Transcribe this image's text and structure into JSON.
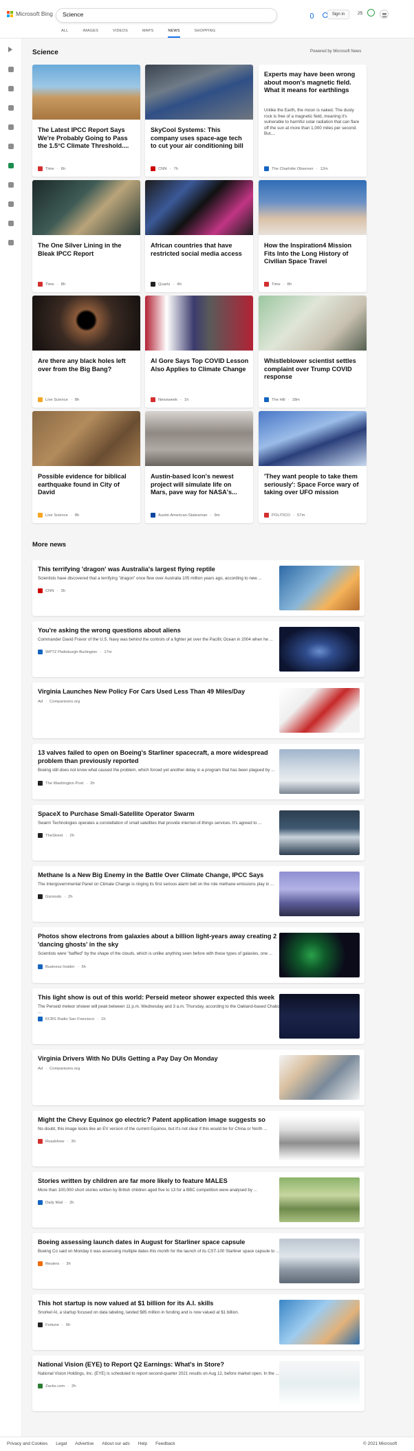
{
  "brand": {
    "name": "Microsoft Bing"
  },
  "search": {
    "query": "Science"
  },
  "header": {
    "signin": "Sign in",
    "points": "25"
  },
  "tabs": [
    {
      "label": "ALL"
    },
    {
      "label": "IMAGES"
    },
    {
      "label": "VIDEOS"
    },
    {
      "label": "MAPS"
    },
    {
      "label": "NEWS",
      "active": true
    },
    {
      "label": "SHOPPING"
    }
  ],
  "section": {
    "title": "Science",
    "powered": "Powered by Microsoft News"
  },
  "cards": [
    {
      "title": "The Latest IPCC Report Says We're Probably Going to Pass the 1.5°C Climate Threshold....",
      "source": "Time",
      "time": "6h",
      "accent": "#d32f2f",
      "img": "linear-gradient(180deg,#6aa9d8 0%,#9cc7e6 40%,#c89a62 60%,#a8763f 100%)"
    },
    {
      "title": "SkyCool Systems: This company uses space-age tech to cut your air conditioning bill",
      "source": "CNN",
      "time": "7h",
      "accent": "#cc0000",
      "img": "linear-gradient(160deg,#3b4450 0%,#6f7b88 35%,#2f4f86 55%,#6e7680 100%)"
    },
    {
      "title": "Experts may have been wrong about moon's magnetic field. What it means for earthlings",
      "summary": "Unlike the Earth, the moon is naked. The dusty rock is free of a magnetic field, meaning it's vulnerable to harmful solar radiation that can flare off the sun at more than 1,000 miles per second. But....",
      "source": "The Charlotte Observer",
      "time": "12m",
      "accent": "#1565c0",
      "textonly": true
    },
    {
      "title": "The One Silver Lining in the Bleak IPCC Report",
      "source": "Time",
      "time": "8h",
      "accent": "#d32f2f",
      "img": "linear-gradient(135deg,#1c2a2a 0%,#3e5b55 40%,#b9a47a 60%,#2a3a35 100%)"
    },
    {
      "title": "African countries that have restricted social media access",
      "source": "Quartz",
      "time": "4h",
      "accent": "#222222",
      "img": "linear-gradient(135deg,#1d1d1d 0%,#3b5998 30%,#111 50%,#c13584 75%,#1d1d1d 100%)"
    },
    {
      "title": "How the Inspiration4 Mission Fits Into the Long History of Civilian Space Travel",
      "source": "Time",
      "time": "8h",
      "accent": "#d32f2f",
      "img": "linear-gradient(180deg,#2f6db6 0%,#6a91c6 40%,#d9c1a8 70%,#e8e2da 100%)"
    },
    {
      "title": "Are there any black holes left over from the Big Bang?",
      "source": "Live Science",
      "time": "8h",
      "accent": "#f5a623",
      "img": "radial-gradient(circle at 50% 45%,#000 0,#000 12px,#8a5a3a 16px,#3a2a22 40px,#1a1412 80px)"
    },
    {
      "title": "Al Gore Says Top COVID Lesson Also Applies to Climate Change",
      "source": "Newsweek",
      "time": "1h",
      "accent": "#d32f2f",
      "img": "linear-gradient(90deg,#b22234 0%,#ffffff 20%,#3c3b6e 45%,#5a5a5a 60%,#b22234 100%)"
    },
    {
      "title": "Whistleblower scientist settles complaint over Trump COVID response",
      "source": "The Hill",
      "time": "18m",
      "accent": "#1565c0",
      "img": "linear-gradient(135deg,#9cc7a0 0%,#dfe6d8 40%,#c8c0b0 70%,#556050 100%)"
    },
    {
      "title": "Possible evidence for biblical earthquake found in City of David",
      "source": "Live Science",
      "time": "8h",
      "accent": "#f5a623",
      "img": "linear-gradient(135deg,#8a6a45 0%,#b38b5c 40%,#6a4e32 70%,#a27d51 100%)"
    },
    {
      "title": "Austin-based Icon's newest project will simulate life on Mars, pave way for NASA's...",
      "source": "Austin American-Statesman",
      "time": "9m",
      "accent": "#0d47a1",
      "img": "linear-gradient(180deg,#d8d4d0 0%,#8f8883 40%,#b0aaa5 70%,#6b6560 100%)"
    },
    {
      "title": "'They want people to take them seriously': Space Force wary of taking over UFO mission",
      "source": "POLITICO",
      "time": "57m",
      "accent": "#d32f2f",
      "img": "linear-gradient(160deg,#4a78c8 0%,#9bbce8 40%,#2a3f7a 60%,#c8d8ee 100%)"
    }
  ],
  "more_news": {
    "title": "More news",
    "items": [
      {
        "title": "This terrifying 'dragon' was Australia's largest flying reptile",
        "summary": "Scientists have discovered that a terrifying \"dragon\" once flew over Australia 105 million years ago, according to new ...",
        "source": "CNN",
        "time": "3h",
        "accent": "#cc0000",
        "img": "linear-gradient(135deg,#2e6aa7 0%,#88b6d9 45%,#f4b35a 70%,#b56a2a 100%)"
      },
      {
        "title": "You're asking the wrong questions about aliens",
        "summary": "Commander David Fravor of the U.S. Navy was behind the controls of a fighter jet over the Pacific Ocean in 2004 when he ...",
        "source": "WPTZ Plattsburgh-Burlington",
        "time": "17m",
        "accent": "#1565c0",
        "img": "radial-gradient(ellipse at 50% 55%,#6a8ed0 0,#2f4c8c 20px,#0d1430 60px)"
      },
      {
        "title": "Virginia Launches New Policy For Cars Used Less Than 49 Miles/Day",
        "summary": "",
        "source": "Comparisons.org",
        "ad": "Ad",
        "time": "",
        "accent": "#999999",
        "img": "linear-gradient(135deg,#ffffff 0%,#efefef 30%,#c62828 55%,#f2f2f2 80%)"
      },
      {
        "title": "13 valves failed to open on Boeing's Starliner spacecraft, a more widespread problem than previously reported",
        "summary": "Boeing still does not know what caused the problem, which forced yet another delay in a program that has been plagued by ...",
        "source": "The Washington Post",
        "time": "2h",
        "accent": "#222222",
        "img": "linear-gradient(180deg,#9fb4cc 0%,#cfd8e2 40%,#e8ecf0 70%,#7c8794 100%)"
      },
      {
        "title": "SpaceX to Purchase Small-Satellite Operator Swarm",
        "summary": "Swarm Technologies operates a constellation of small satellites that provide internet-of-things services. It's agreed to ...",
        "source": "TheStreet",
        "time": "2h",
        "accent": "#222222",
        "img": "linear-gradient(180deg,#2d3e50 0%,#3f5870 40%,#c9d3dc 60%,#2d3e50 100%)"
      },
      {
        "title": "Methane Is a New Big Enemy in the Battle Over Climate Change, IPCC Says",
        "summary": "The Intergovernmental Panel on Climate Change is ringing its first serious alarm bell on the role methane emissions play in ...",
        "source": "Gizmodo",
        "time": "2h",
        "accent": "#222222",
        "img": "linear-gradient(180deg,#8f8fd2 0%,#b3b3e6 40%,#5d5d9a 70%,#2e2e4a 100%)"
      },
      {
        "title": "Photos show electrons from galaxies about a billion light-years away creating 2 'dancing ghosts' in the sky",
        "summary": "Scientists were \"baffled\" by the shape of the clouds, which is unlike anything seen before with these types of galaxies, one ...",
        "source": "Business Insider",
        "time": "5h",
        "accent": "#1565c0",
        "img": "radial-gradient(circle at 40% 50%,#2aa04a 0,#0f5a2a 20px,#0b0b1a 50px)"
      },
      {
        "title": "This light show is out of this world: Perseid meteor shower expected this week",
        "summary": "The Perseid meteor shower will peak between 11 p.m. Wednesday and 3 a.m. Thursday, according to the Oakland-based Chabot ...",
        "source": "KCBS Radio San Francisco",
        "time": "1h",
        "accent": "#1565c0",
        "img": "linear-gradient(180deg,#0c1024 0%,#1b2448 50%,#10183a 100%)"
      },
      {
        "title": "Virginia Drivers With No DUIs Getting a Pay Day On Monday",
        "summary": "",
        "source": "Comparisons.org",
        "ad": "Ad",
        "time": "",
        "accent": "#999999",
        "img": "linear-gradient(135deg,#f2f2f2 0%,#d9c0a0 30%,#7a8a9a 60%,#f2f2f2 100%)"
      },
      {
        "title": "Might the Chevy Equinox go electric? Patent application image suggests so",
        "summary": "No doubt, this image looks like an EV version of the current Equinox, but it's not clear if this would be for China or North ...",
        "source": "Roadshow",
        "time": "3h",
        "accent": "#d32f2f",
        "img": "linear-gradient(180deg,#ffffff 0%,#dcdcdc 30%,#8e8e8e 60%,#ffffff 100%)"
      },
      {
        "title": "Stories written by children are far more likely to feature MALES",
        "summary": "More than 100,000 short stories written by British children aged five to 13 for a BBC competition were analysed by ...",
        "source": "Daily Mail",
        "time": "2h",
        "accent": "#1565c0",
        "img": "linear-gradient(180deg,#8bb36a 0%,#c8d6a0 40%,#6e8a4c 70%,#a9c080 100%)"
      },
      {
        "title": "Boeing assessing launch dates in August for Starliner space capsule",
        "summary": "Boeing Co said on Monday it was assessing multiple dates this month for the launch of its CST-100 Starliner space capsule to ...",
        "source": "Reuters",
        "time": "3h",
        "accent": "#ef6c00",
        "img": "linear-gradient(180deg,#bcc6d0 0%,#dfe5ea 40%,#8d98a4 70%,#5f6a76 100%)"
      },
      {
        "title": "This hot startup is now valued at $1 billion for its A.I. skills",
        "summary": "Snorkel AI, a startup focused on data labeling, landed $85 million in funding and is now valued at $1 billion.",
        "source": "Fortune",
        "time": "6h",
        "accent": "#222222",
        "img": "linear-gradient(135deg,#3b86c6 0%,#9ccbef 40%,#e2b27a 70%,#2f6ea8 100%)"
      },
      {
        "title": "National Vision (EYE) to Report Q2 Earnings: What's in Store?",
        "summary": "National Vision Holdings, Inc. (EYE) is scheduled to report second-quarter 2021 results on Aug 12, before market open. In the ...",
        "source": "Zacks.com",
        "time": "2h",
        "accent": "#2e7d32",
        "img": "linear-gradient(180deg,#f7f7f7 0%,#e6eef0 50%,#ffffff 100%)"
      }
    ]
  },
  "footer": {
    "links": [
      "Privacy and Cookies",
      "Legal",
      "Advertise",
      "About our ads",
      "Help",
      "Feedback"
    ],
    "copyright": "© 2021 Microsoft"
  }
}
